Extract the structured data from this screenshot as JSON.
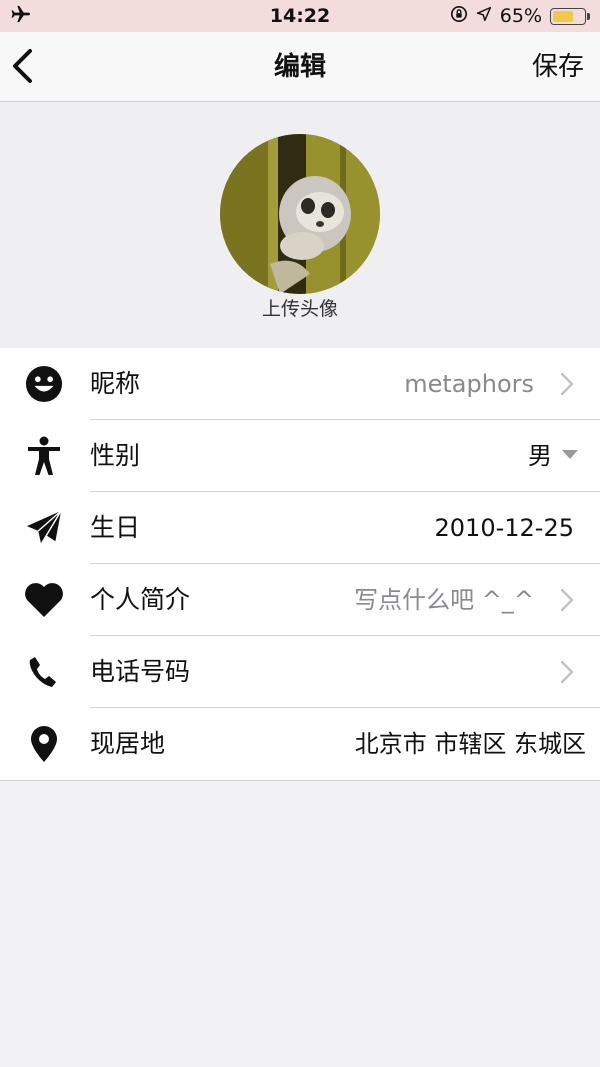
{
  "status_bar": {
    "time": "14:22",
    "battery_text": "65%",
    "battery_level": 0.65,
    "icons": [
      "airplane-icon",
      "rotation-lock-icon",
      "location-arrow-icon",
      "battery-icon"
    ]
  },
  "nav": {
    "title": "编辑",
    "save_label": "保存",
    "back_icon": "chevron-left-icon"
  },
  "avatar": {
    "caption": "上传头像"
  },
  "rows": [
    {
      "icon": "smiley-icon",
      "label": "昵称",
      "value": "metaphors",
      "value_style": "muted",
      "accessory": "chevron"
    },
    {
      "icon": "person-icon",
      "label": "性别",
      "value": "男",
      "value_style": "dark",
      "accessory": "dropdown"
    },
    {
      "icon": "paper-plane-icon",
      "label": "生日",
      "value": "2010-12-25",
      "value_style": "dark",
      "accessory": "none"
    },
    {
      "icon": "heart-icon",
      "label": "个人简介",
      "value": "写点什么吧 ^_^",
      "value_style": "muted",
      "accessory": "chevron"
    },
    {
      "icon": "phone-icon",
      "label": "电话号码",
      "value": "",
      "value_style": "muted",
      "accessory": "chevron"
    },
    {
      "icon": "map-pin-icon",
      "label": "现居地",
      "value": "北京市 市辖区 东城区",
      "value_style": "dark",
      "accessory": "none"
    }
  ]
}
